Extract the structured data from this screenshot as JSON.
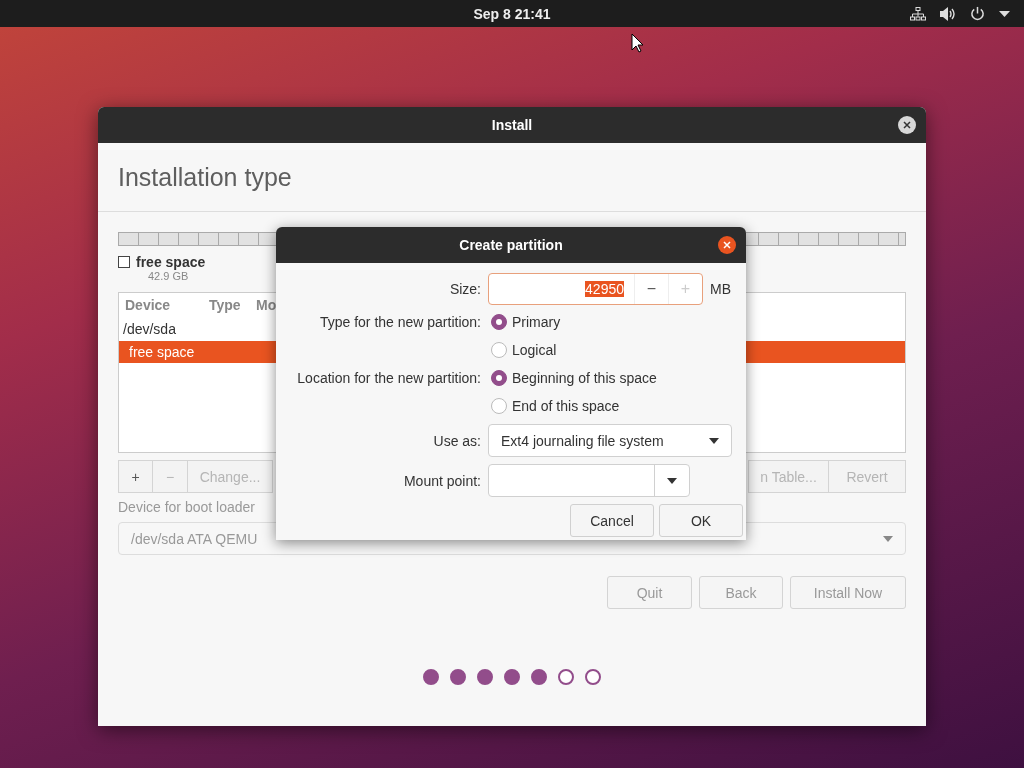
{
  "top_bar": {
    "clock": "Sep 8  21:41"
  },
  "install_window": {
    "title": "Install",
    "heading": "Installation type",
    "legend": {
      "label": "free space",
      "size": "42.9 GB"
    },
    "table": {
      "columns": [
        "Device",
        "Type",
        "Mo"
      ],
      "rows": [
        {
          "device": "/dev/sda",
          "selected": false,
          "children": [
            {
              "device": "free space",
              "selected": true
            }
          ]
        }
      ]
    },
    "partition_buttons": [
      {
        "label": "+",
        "disabled": false
      },
      {
        "label": "−",
        "disabled": true
      },
      {
        "label": "Change...",
        "disabled": true
      },
      {
        "label": "n Table...",
        "disabled": true
      },
      {
        "label": "Revert",
        "disabled": true
      }
    ],
    "boot_loader_label": "Device for boot loader",
    "boot_loader_device": "/dev/sda ATA QEMU",
    "buttons": [
      {
        "label": "Quit",
        "disabled": true
      },
      {
        "label": "Back",
        "disabled": true
      },
      {
        "label": "Install Now",
        "disabled": true
      }
    ],
    "steps": [
      {
        "done": true
      },
      {
        "done": true
      },
      {
        "done": true
      },
      {
        "done": true
      },
      {
        "done": true
      },
      {
        "done": false
      },
      {
        "done": false
      }
    ]
  },
  "dialog": {
    "title": "Create partition",
    "size": {
      "label": "Size:",
      "value": "42950",
      "minus": "−",
      "plus": "+",
      "plus_disabled": true,
      "unit": "MB"
    },
    "groups": [
      {
        "label": "Type for the new partition:",
        "options": [
          {
            "label": "Primary",
            "selected": true
          },
          {
            "label": "Logical",
            "selected": false
          }
        ]
      },
      {
        "label": "Location for the new partition:",
        "options": [
          {
            "label": "Beginning of this space",
            "selected": true
          },
          {
            "label": "End of this space",
            "selected": false
          }
        ]
      }
    ],
    "use_as": {
      "label": "Use as:",
      "value": "Ext4 journaling file system"
    },
    "mount_point": {
      "label": "Mount point:"
    },
    "buttons": [
      "Cancel",
      "OK"
    ]
  }
}
